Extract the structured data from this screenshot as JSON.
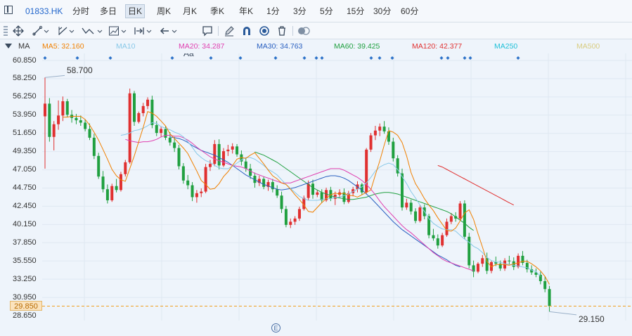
{
  "toolbar": {
    "ticker": "01833.HK",
    "timeframes": [
      "分时",
      "多日",
      "日K",
      "周K",
      "月K",
      "季K",
      "年K",
      "1分",
      "3分",
      "5分",
      "15分",
      "30分",
      "60分"
    ],
    "active_timeframe": "日K"
  },
  "drawing_tools": [
    "crosshair-icon",
    "line-tool-icon",
    "channel-tool-icon",
    "wave-tool-icon",
    "fib-tool-icon",
    "measure-tool-icon",
    "arrow-left-icon",
    "text-tool-icon",
    "comment-icon",
    "pen-icon",
    "magnet-icon",
    "eye-icon",
    "trash-icon",
    "toggle-icon"
  ],
  "drawing_text": {
    "text_tool": "Aa"
  },
  "indicator": {
    "name": "MA",
    "items": [
      {
        "label": "MA5: 32.160",
        "color": "#f08000"
      },
      {
        "label": "MA10",
        "color": "#88c8e8"
      },
      {
        "label": "MA20: 34.287",
        "color": "#e040b0"
      },
      {
        "label": "MA30: 34.763",
        "color": "#2a60c0"
      },
      {
        "label": "MA60: 39.425",
        "color": "#20a040"
      },
      {
        "label": "MA120: 42.377",
        "color": "#e03030"
      },
      {
        "label": "MA250",
        "color": "#20c0d8"
      },
      {
        "label": "MA500",
        "color": "#d8cc80"
      }
    ]
  },
  "y_axis": {
    "labels": [
      "60.850",
      "58.250",
      "56.250",
      "53.950",
      "51.650",
      "49.350",
      "47.050",
      "44.750",
      "42.450",
      "40.150",
      "37.850",
      "35.550",
      "33.250",
      "30.950",
      "29.850",
      "28.650"
    ]
  },
  "annotations": {
    "high": "58.700",
    "low": "29.150",
    "last_price": "29.850"
  },
  "misc": {
    "event_marker": "E"
  },
  "colors": {
    "up": "#e03030",
    "down": "#20a040",
    "grid": "#dfe8f2"
  },
  "chart_data": {
    "type": "candlestick",
    "y_range": [
      28.65,
      60.85
    ],
    "last_price": 29.85,
    "high": 58.7,
    "low": 29.15,
    "candles": [
      [
        53.8,
        58.7,
        47.2,
        55.4
      ],
      [
        55.4,
        56.1,
        50.6,
        51.2
      ],
      [
        51.2,
        53.2,
        49.5,
        52.8
      ],
      [
        52.8,
        55.8,
        52.1,
        53.9
      ],
      [
        53.9,
        56.3,
        53.2,
        55.7
      ],
      [
        55.7,
        56.0,
        53.7,
        54.0
      ],
      [
        54.0,
        54.6,
        53.0,
        53.6
      ],
      [
        53.6,
        54.1,
        52.8,
        53.3
      ],
      [
        53.3,
        53.9,
        52.6,
        53.0
      ],
      [
        53.0,
        53.4,
        51.9,
        52.2
      ],
      [
        52.2,
        52.9,
        50.8,
        51.1
      ],
      [
        51.1,
        51.6,
        48.4,
        48.8
      ],
      [
        48.8,
        49.2,
        45.9,
        46.2
      ],
      [
        46.2,
        46.9,
        44.2,
        44.6
      ],
      [
        44.6,
        45.2,
        42.8,
        43.2
      ],
      [
        43.2,
        45.3,
        43.0,
        45.0
      ],
      [
        45.0,
        45.9,
        44.2,
        44.5
      ],
      [
        44.5,
        46.8,
        44.3,
        46.5
      ],
      [
        46.5,
        48.3,
        46.2,
        48.0
      ],
      [
        48.0,
        57.3,
        47.8,
        56.7
      ],
      [
        56.7,
        57.0,
        52.6,
        53.1
      ],
      [
        53.1,
        54.4,
        52.9,
        54.2
      ],
      [
        54.2,
        55.5,
        53.8,
        55.1
      ],
      [
        55.1,
        56.2,
        54.7,
        55.9
      ],
      [
        55.9,
        56.4,
        52.3,
        52.7
      ],
      [
        52.7,
        53.2,
        51.3,
        51.7
      ],
      [
        51.7,
        52.5,
        51.2,
        52.2
      ],
      [
        52.2,
        52.6,
        50.8,
        51.1
      ],
      [
        51.1,
        51.8,
        50.1,
        50.5
      ],
      [
        50.5,
        51.2,
        49.3,
        49.8
      ],
      [
        49.8,
        50.2,
        47.1,
        47.5
      ],
      [
        47.5,
        47.9,
        45.3,
        45.7
      ],
      [
        45.7,
        46.4,
        44.6,
        45.1
      ],
      [
        45.1,
        45.5,
        43.1,
        43.6
      ],
      [
        43.6,
        44.5,
        42.9,
        44.1
      ],
      [
        44.1,
        44.7,
        43.6,
        44.3
      ],
      [
        44.3,
        47.8,
        44.1,
        47.4
      ],
      [
        47.4,
        48.3,
        46.9,
        47.8
      ],
      [
        47.8,
        50.8,
        47.5,
        50.3
      ],
      [
        50.3,
        50.9,
        47.1,
        47.6
      ],
      [
        47.6,
        49.8,
        47.4,
        49.4
      ],
      [
        49.4,
        50.2,
        48.8,
        49.6
      ],
      [
        49.6,
        50.4,
        49.1,
        50.0
      ],
      [
        50.0,
        50.3,
        48.7,
        49.0
      ],
      [
        49.0,
        49.5,
        47.6,
        48.1
      ],
      [
        48.1,
        48.6,
        46.8,
        47.2
      ],
      [
        47.2,
        47.8,
        45.9,
        46.3
      ],
      [
        46.3,
        46.7,
        44.8,
        45.4
      ],
      [
        45.4,
        46.3,
        45.0,
        45.9
      ],
      [
        45.9,
        46.2,
        44.6,
        44.9
      ],
      [
        44.9,
        45.8,
        44.4,
        45.5
      ],
      [
        45.5,
        45.9,
        44.2,
        44.6
      ],
      [
        44.6,
        45.1,
        43.5,
        43.8
      ],
      [
        43.8,
        44.3,
        41.6,
        42.1
      ],
      [
        42.1,
        42.5,
        39.8,
        40.1
      ],
      [
        40.1,
        40.9,
        39.7,
        40.5
      ],
      [
        40.5,
        41.2,
        40.1,
        40.9
      ],
      [
        40.9,
        42.4,
        40.6,
        42.1
      ],
      [
        42.1,
        43.8,
        41.9,
        43.5
      ],
      [
        43.5,
        45.7,
        43.2,
        45.3
      ],
      [
        45.3,
        45.8,
        43.4,
        43.9
      ],
      [
        43.9,
        44.5,
        43.6,
        44.2
      ],
      [
        44.2,
        44.6,
        42.9,
        43.2
      ],
      [
        43.2,
        44.8,
        43.0,
        44.5
      ],
      [
        44.5,
        44.9,
        43.1,
        43.4
      ],
      [
        43.4,
        44.3,
        42.6,
        43.9
      ],
      [
        43.9,
        44.6,
        43.5,
        44.2
      ],
      [
        44.2,
        44.7,
        42.7,
        43.0
      ],
      [
        43.0,
        44.4,
        42.8,
        44.1
      ],
      [
        44.1,
        44.9,
        43.7,
        44.6
      ],
      [
        44.6,
        45.6,
        44.2,
        45.2
      ],
      [
        45.2,
        45.4,
        43.9,
        44.2
      ],
      [
        44.2,
        49.8,
        44.0,
        49.6
      ],
      [
        49.6,
        51.7,
        49.3,
        51.4
      ],
      [
        51.4,
        52.6,
        50.8,
        52.0
      ],
      [
        52.0,
        52.9,
        51.3,
        52.5
      ],
      [
        52.5,
        53.2,
        51.6,
        51.9
      ],
      [
        51.9,
        52.4,
        50.2,
        50.6
      ],
      [
        50.6,
        51.1,
        48.1,
        48.5
      ],
      [
        48.5,
        48.9,
        46.2,
        46.6
      ],
      [
        46.6,
        47.2,
        41.9,
        42.3
      ],
      [
        42.3,
        43.4,
        42.0,
        42.9
      ],
      [
        42.9,
        43.3,
        41.4,
        41.8
      ],
      [
        41.8,
        42.2,
        40.3,
        40.6
      ],
      [
        40.6,
        42.6,
        40.4,
        42.3
      ],
      [
        42.3,
        42.7,
        40.8,
        41.2
      ],
      [
        41.2,
        41.5,
        38.4,
        38.8
      ],
      [
        38.8,
        39.6,
        38.1,
        38.4
      ],
      [
        38.4,
        38.9,
        37.1,
        37.5
      ],
      [
        37.5,
        39.1,
        37.3,
        38.8
      ],
      [
        38.8,
        40.9,
        38.6,
        40.5
      ],
      [
        40.5,
        41.6,
        40.2,
        41.2
      ],
      [
        41.2,
        41.7,
        40.5,
        40.9
      ],
      [
        40.9,
        43.1,
        40.7,
        42.8
      ],
      [
        42.8,
        43.2,
        38.3,
        38.6
      ],
      [
        38.6,
        39.1,
        34.6,
        35.0
      ],
      [
        35.0,
        35.6,
        33.5,
        34.2
      ],
      [
        34.2,
        35.4,
        34.0,
        35.2
      ],
      [
        35.2,
        36.3,
        34.8,
        35.9
      ],
      [
        35.9,
        36.6,
        33.9,
        34.3
      ],
      [
        34.3,
        35.6,
        34.0,
        35.4
      ],
      [
        35.4,
        36.1,
        34.9,
        35.2
      ],
      [
        35.2,
        35.6,
        34.3,
        34.6
      ],
      [
        34.6,
        35.9,
        34.3,
        35.6
      ],
      [
        35.6,
        36.2,
        35.1,
        35.5
      ],
      [
        35.5,
        36.0,
        34.4,
        34.8
      ],
      [
        34.8,
        36.5,
        34.6,
        36.2
      ],
      [
        36.2,
        36.8,
        35.0,
        35.3
      ],
      [
        35.3,
        35.7,
        34.1,
        34.5
      ],
      [
        34.5,
        35.0,
        33.8,
        34.1
      ],
      [
        34.1,
        34.6,
        33.5,
        33.8
      ],
      [
        33.8,
        34.2,
        32.6,
        33.0
      ],
      [
        33.0,
        33.6,
        31.6,
        32.0
      ],
      [
        32.0,
        32.4,
        29.15,
        29.85
      ]
    ],
    "moving_averages": {
      "MA10": {
        "start": 17,
        "values": [
          51.4,
          51.5,
          51.7,
          52.0,
          52.1,
          52.3,
          52.6,
          53.0,
          52.9,
          52.5,
          52.3,
          52.1,
          51.8,
          51.6,
          51.2,
          50.6,
          49.9,
          49.1,
          48.6,
          48.2,
          48.0,
          47.6,
          47.3,
          47.2,
          47.2,
          47.5,
          47.9,
          48.3,
          48.6,
          48.6,
          48.4,
          48.0,
          47.6,
          47.1,
          46.8,
          46.4,
          45.8,
          45.2,
          44.7,
          44.2,
          43.7,
          43.4,
          43.2,
          43.2,
          43.2,
          43.3,
          43.4,
          43.4,
          43.6,
          43.6,
          43.8,
          44.0,
          44.3,
          44.6,
          44.9,
          45.4,
          46.1,
          46.9,
          47.4,
          47.7,
          47.9,
          47.7,
          47.1,
          46.2,
          45.3,
          44.3,
          43.5,
          42.6,
          41.8,
          40.9,
          40.3,
          39.9,
          39.6,
          39.5,
          39.5,
          39.3,
          38.8,
          38.3,
          37.9,
          37.4,
          37.1,
          36.6,
          36.0,
          35.6,
          35.4,
          35.4,
          35.2,
          35.1,
          35.0,
          34.9,
          34.8,
          34.7,
          34.4,
          34.2,
          33.6
        ],
        "color": "#88c8e8"
      },
      "MA20": {
        "start": 18,
        "values": [
          50.9,
          50.7,
          50.6,
          50.5,
          50.6,
          50.6,
          50.7,
          50.9,
          51.2,
          51.4,
          51.4,
          51.3,
          51.3,
          51.1,
          50.8,
          50.4,
          49.9,
          49.5,
          49.1,
          48.7,
          48.4,
          48.2,
          48.0,
          47.8,
          47.6,
          47.5,
          47.4,
          47.2,
          46.9,
          46.6,
          46.4,
          46.2,
          46.0,
          45.8,
          45.6,
          45.4,
          45.4,
          45.4,
          45.6,
          45.8,
          46.0,
          46.2,
          46.4,
          46.6,
          46.8,
          47.0,
          47.2,
          47.2,
          47.2,
          47.0,
          46.7,
          46.4,
          46.1,
          45.7,
          45.2,
          44.6,
          43.9,
          43.1,
          42.4,
          41.8,
          41.2,
          40.6,
          40.0,
          39.5,
          39.1,
          38.6,
          38.1,
          37.6,
          37.1,
          36.6,
          36.2,
          35.8,
          35.5,
          35.3,
          35.1,
          34.9,
          34.7,
          34.5,
          34.3
        ],
        "color": "#e040b0"
      },
      "MA30": {
        "start": 28,
        "values": [
          51.2,
          51.1,
          51.0,
          50.8,
          50.5,
          50.1,
          49.8,
          49.5,
          49.3,
          49.1,
          48.9,
          48.6,
          48.3,
          48.0,
          47.6,
          47.2,
          46.8,
          46.4,
          46.1,
          45.8,
          45.5,
          45.2,
          45.0,
          44.8,
          44.6,
          44.5,
          44.6,
          44.7,
          44.8,
          45.0,
          45.2,
          45.4,
          45.6,
          45.8,
          46.0,
          46.2,
          46.3,
          46.3,
          46.2,
          46.0,
          45.7,
          45.3,
          44.9,
          44.5,
          44.0,
          43.5,
          42.9,
          42.3,
          41.7,
          41.1,
          40.5,
          40.0,
          39.5,
          39.1,
          38.7,
          38.3,
          37.9,
          37.5,
          37.1,
          36.7,
          36.3,
          36.0,
          35.7,
          35.3,
          35.0,
          34.8
        ],
        "color": "#2a60c0"
      },
      "MA60": {
        "start": 47,
        "values": [
          49.3,
          49.1,
          48.9,
          48.6,
          48.3,
          48.0,
          47.6,
          47.2,
          46.8,
          46.4,
          46.0,
          45.6,
          45.2,
          44.8,
          44.5,
          44.2,
          44.0,
          43.8,
          43.6,
          43.5,
          43.4,
          43.3,
          43.3,
          43.4,
          43.5,
          43.6,
          43.8,
          44.0,
          44.1,
          44.2,
          44.2,
          44.1,
          44.0,
          43.8,
          43.6,
          43.4,
          43.2,
          43.0,
          42.8,
          42.6,
          42.4,
          42.2,
          42.0,
          41.8,
          41.5,
          41.1,
          40.7,
          40.3,
          39.8,
          39.4
        ],
        "color": "#20a040"
      },
      "MA120": {
        "start": 88,
        "values": [
          47.6,
          47.4,
          47.1,
          46.8,
          46.5,
          46.2,
          45.9,
          45.6,
          45.3,
          45.0,
          44.7,
          44.4,
          44.1,
          43.8,
          43.5,
          43.2,
          42.9,
          42.6
        ],
        "color": "#e03030"
      },
      "MA5": {
        "start": 4,
        "values": [
          53.7,
          53.7,
          53.8,
          53.8,
          53.8,
          53.4,
          52.7,
          51.8,
          50.8,
          49.6,
          48.4,
          47.1,
          46.3,
          45.8,
          45.6,
          47.2,
          48.8,
          50.6,
          52.4,
          54.4,
          54.2,
          53.8,
          53.2,
          52.6,
          51.6,
          51.0,
          50.4,
          49.8,
          49.1,
          48.0,
          46.9,
          45.7,
          45.2,
          44.6,
          44.7,
          45.3,
          46.2,
          46.8,
          47.6,
          48.4,
          48.6,
          48.5,
          48.9,
          49.2,
          48.5,
          47.8,
          47.0,
          46.3,
          45.9,
          45.4,
          45.2,
          44.6,
          43.9,
          43.3,
          42.6,
          41.8,
          41.7,
          42.3,
          42.9,
          43.4,
          43.9,
          44.1,
          44.0,
          44.1,
          43.8,
          43.8,
          43.6,
          43.9,
          44.2,
          44.5,
          46.4,
          48.2,
          50.2,
          52.0,
          51.8,
          51.4,
          50.5,
          48.8,
          46.7,
          45.3,
          44.4,
          43.4,
          42.6,
          41.9,
          41.0,
          40.2,
          39.4,
          39.3,
          39.7,
          40.6,
          41.6,
          42.0,
          40.8,
          39.0,
          37.3,
          35.5,
          34.8,
          35.1,
          35.1,
          35.1,
          35.0,
          35.2,
          35.3,
          35.5,
          35.5,
          35.2,
          34.8,
          34.3,
          33.6,
          32.6
        ],
        "color": "#f08000"
      }
    }
  }
}
